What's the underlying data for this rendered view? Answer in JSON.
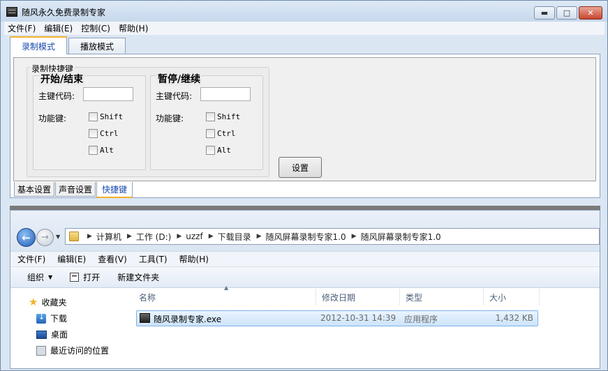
{
  "window": {
    "title": "随风永久免费录制专家",
    "controls": {
      "minimize": "▬",
      "maximize": "□",
      "close": "✕"
    }
  },
  "menu": [
    "文件(F)",
    "编辑(E)",
    "控制(C)",
    "帮助(H)"
  ],
  "top_tabs": [
    "录制模式",
    "播放模式"
  ],
  "hotkeys": {
    "legend": "录制快捷键",
    "groups": [
      {
        "heading": "开始/结束",
        "main_key_label": "主键代码:",
        "main_key_value": "",
        "modifier_label": "功能键:",
        "modifiers": [
          "Shift",
          "Ctrl",
          "Alt"
        ]
      },
      {
        "heading": "暂停/继续",
        "main_key_label": "主键代码:",
        "main_key_value": "",
        "modifier_label": "功能键:",
        "modifiers": [
          "Shift",
          "Ctrl",
          "Alt"
        ]
      }
    ],
    "set_button": "设置"
  },
  "bottom_tabs": [
    "基本设置",
    "声音设置",
    "快捷键"
  ],
  "explorer": {
    "breadcrumbs": [
      "计算机",
      "工作 (D:)",
      "uzzf",
      "下载目录",
      "随风屏幕录制专家1.0",
      "随风屏幕录制专家1.0"
    ],
    "menu": [
      "文件(F)",
      "编辑(E)",
      "查看(V)",
      "工具(T)",
      "帮助(H)"
    ],
    "toolbar": {
      "organize": "组织",
      "open": "打开",
      "new_folder": "新建文件夹"
    },
    "nav": [
      "收藏夹",
      "下载",
      "桌面",
      "最近访问的位置"
    ],
    "columns": [
      "名称",
      "修改日期",
      "类型",
      "大小"
    ],
    "files": [
      {
        "name": "随风录制专家.exe",
        "modified": "2012-10-31 14:39",
        "type": "应用程序",
        "size": "1,432 KB"
      }
    ]
  }
}
